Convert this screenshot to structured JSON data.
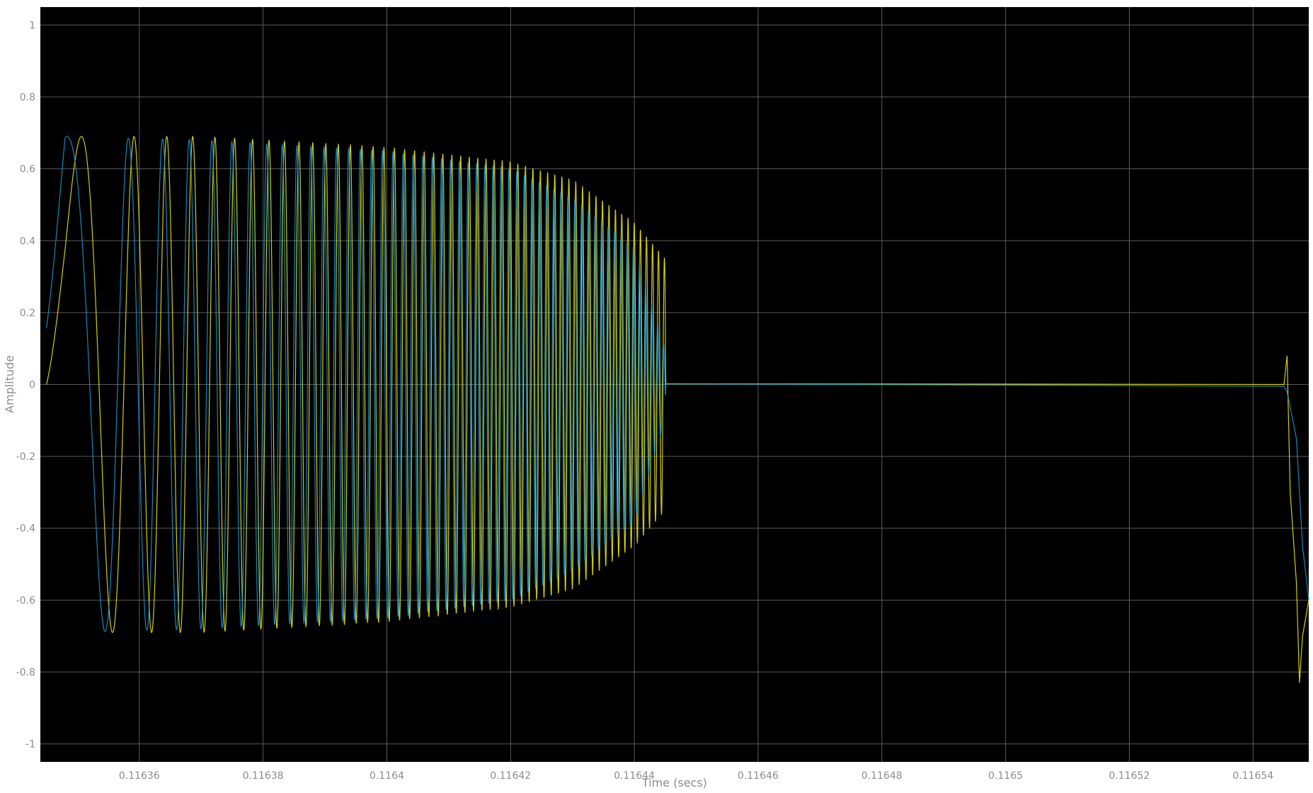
{
  "chart_data": {
    "type": "line",
    "title": "",
    "xlabel": "Time (secs)",
    "ylabel": "Amplitude",
    "xlim": [
      0.116344,
      0.116549
    ],
    "ylim": [
      -1.05,
      1.05
    ],
    "grid": true,
    "background": "#000000",
    "grid_color": "#5a5a5a",
    "text_color": "#8c8c8c",
    "x_ticks": [
      {
        "value": 0.11636,
        "label": "0.11636"
      },
      {
        "value": 0.11638,
        "label": "0.11638"
      },
      {
        "value": 0.1164,
        "label": "0.1164"
      },
      {
        "value": 0.11642,
        "label": "0.11642"
      },
      {
        "value": 0.11644,
        "label": "0.11644"
      },
      {
        "value": 0.11646,
        "label": "0.11646"
      },
      {
        "value": 0.11648,
        "label": "0.11648"
      },
      {
        "value": 0.1165,
        "label": "0.1165"
      },
      {
        "value": 0.11652,
        "label": "0.11652"
      },
      {
        "value": 0.11654,
        "label": "0.11654"
      }
    ],
    "y_ticks": [
      {
        "value": 1,
        "label": "1"
      },
      {
        "value": 0.8,
        "label": "0.8"
      },
      {
        "value": 0.6,
        "label": "0.6"
      },
      {
        "value": 0.4,
        "label": "0.4"
      },
      {
        "value": 0.2,
        "label": "0.2"
      },
      {
        "value": 0,
        "label": "0"
      },
      {
        "value": -0.2,
        "label": "-0.2"
      },
      {
        "value": -0.4,
        "label": "-0.4"
      },
      {
        "value": -0.6,
        "label": "-0.6"
      },
      {
        "value": -0.8,
        "label": "-0.8"
      },
      {
        "value": -1,
        "label": "-1"
      }
    ],
    "series": [
      {
        "color": "#e6e31a",
        "burst": {
          "t_start": 0.116345,
          "t_end": 0.1164451
        },
        "envelope": [
          [
            0.116345,
            0.8
          ],
          [
            0.116348,
            0.69
          ],
          [
            0.11637,
            0.69
          ],
          [
            0.11638,
            0.68
          ],
          [
            0.1164,
            0.66
          ],
          [
            0.11642,
            0.62
          ],
          [
            0.11643,
            0.57
          ],
          [
            0.11644,
            0.45
          ],
          [
            0.116445,
            0.35
          ],
          [
            0.1164451,
            0.0
          ]
        ],
        "tail": [
          [
            0.1164452,
            0.002
          ],
          [
            0.116545,
            0.0
          ],
          [
            0.1165455,
            0.08
          ],
          [
            0.116546,
            -0.3
          ],
          [
            0.116547,
            -0.55
          ],
          [
            0.1165475,
            -0.83
          ],
          [
            0.116548,
            -0.7
          ],
          [
            0.116549,
            -0.6
          ]
        ]
      },
      {
        "color": "#1f9ed9",
        "burst": {
          "t_start": 0.116345,
          "t_end": 0.1164451
        },
        "envelope": [
          [
            0.116345,
            0.2
          ],
          [
            0.116348,
            0.69
          ],
          [
            0.11637,
            0.68
          ],
          [
            0.11638,
            0.67
          ],
          [
            0.1164,
            0.65
          ],
          [
            0.11642,
            0.6
          ],
          [
            0.11643,
            0.52
          ],
          [
            0.11644,
            0.38
          ],
          [
            0.116445,
            0.1
          ],
          [
            0.1164451,
            0.0
          ]
        ],
        "tail": [
          [
            0.1164452,
            0.002
          ],
          [
            0.116545,
            -0.005
          ],
          [
            0.1165455,
            -0.02
          ],
          [
            0.116547,
            -0.15
          ],
          [
            0.116548,
            -0.45
          ],
          [
            0.116549,
            -0.6
          ]
        ]
      }
    ]
  }
}
